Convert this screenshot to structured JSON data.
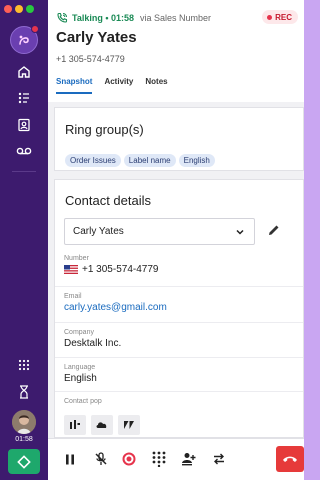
{
  "rail": {
    "window_dots": [
      "#ff5f57",
      "#febc2e",
      "#28c840"
    ],
    "call_time": "01:58",
    "icons": [
      "logo-icon",
      "home-icon",
      "list-icon",
      "contacts-icon",
      "voicemail-icon",
      "apps-grid-icon",
      "timer-icon",
      "avatar",
      "live-call-icon"
    ]
  },
  "header": {
    "status": "Talking • 01:58",
    "via": "via Sales Number",
    "rec_label": "REC",
    "name": "Carly Yates",
    "phone": "+1 305-574-4779",
    "tabs": [
      "Snapshot",
      "Activity",
      "Notes"
    ],
    "active_tab": "Snapshot"
  },
  "ring_groups": {
    "title": "Ring group(s)",
    "chips": [
      "Order Issues",
      "Label name",
      "English"
    ]
  },
  "contact": {
    "title": "Contact details",
    "selected_contact": "Carly Yates",
    "number_label": "Number",
    "number_value": "+1 305-574-4779",
    "email_label": "Email",
    "email_value": "carly.yates@gmail.com",
    "company_label": "Company",
    "company_value": "Desktalk Inc.",
    "language_label": "Language",
    "language_value": "English",
    "contact_pop_label": "Contact pop"
  },
  "callbar": {
    "buttons": [
      "pause-icon",
      "mute-icon",
      "record-icon",
      "keypad-icon",
      "add-participant-icon",
      "transfer-icon",
      "hangup-icon"
    ]
  },
  "colors": {
    "rail_bg": "#3d1b6e",
    "accent_green": "#1a8a55",
    "link_blue": "#1a6bbf",
    "hangup_red": "#e63a3a",
    "rec_red": "#c51a2e"
  }
}
